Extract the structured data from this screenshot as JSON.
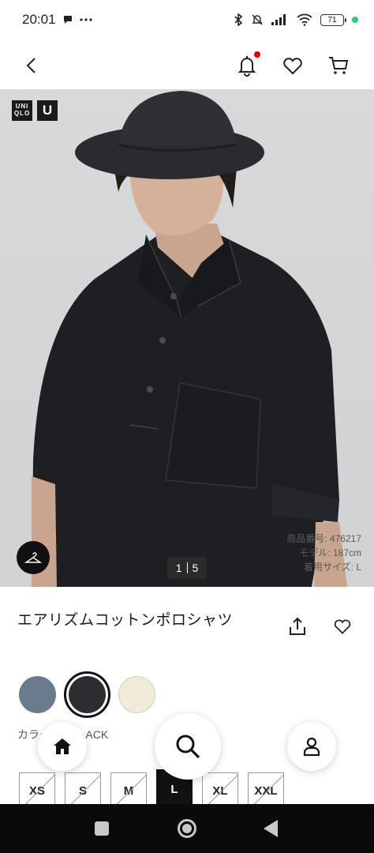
{
  "status_bar": {
    "time": "20:01",
    "battery": "71",
    "icons": [
      "chat-icon",
      "more-icon",
      "bluetooth-icon",
      "mute-icon",
      "signal-icon",
      "wifi-icon",
      "battery-icon"
    ]
  },
  "nav": {
    "back_icon": "chevron-left-icon",
    "notification_icon": "bell-icon",
    "favorite_icon": "heart-icon",
    "cart_icon": "cart-icon",
    "notification_dot_color": "#e00000"
  },
  "hero": {
    "logo_text": "UNIQLO",
    "logo_u": "U",
    "counter_current": "1",
    "counter_total": "5",
    "spec_product_no": "商品番号: 476217",
    "spec_model_height": "モデル: 187cm",
    "spec_size": "着用サイズ: L"
  },
  "product": {
    "name": "エアリズムコットンポロシャツ",
    "color_label": "カラー: 09 BLACK"
  },
  "colors": [
    {
      "name": "blue-gray",
      "hex": "#6b7b8e",
      "selected": false
    },
    {
      "name": "black",
      "hex": "#2b2d31",
      "selected": true
    },
    {
      "name": "off-white",
      "hex": "#f1ead8",
      "selected": false
    }
  ],
  "sizes": [
    {
      "label": "XS",
      "available": false,
      "selected": false
    },
    {
      "label": "S",
      "available": false,
      "selected": false
    },
    {
      "label": "M",
      "available": false,
      "selected": false
    },
    {
      "label": "L",
      "available": true,
      "selected": true
    },
    {
      "label": "XL",
      "available": false,
      "selected": false
    },
    {
      "label": "XXL",
      "available": false,
      "selected": false
    }
  ],
  "bottom_nav": {
    "home_icon": "home-icon",
    "search_icon": "search-icon",
    "account_icon": "account-icon"
  }
}
